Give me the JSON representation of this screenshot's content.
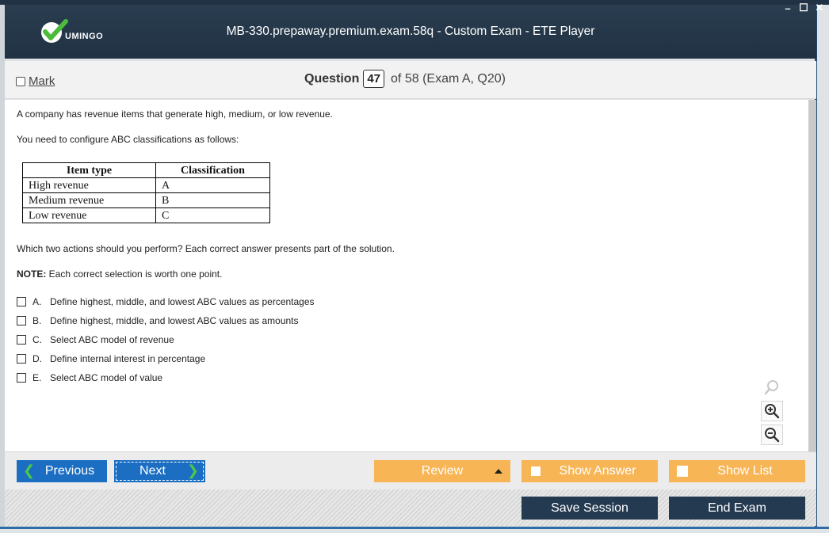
{
  "window": {
    "title": "MB-330.prepaway.premium.exam.58q - Custom Exam - ETE Player",
    "logo_text": "UMINGO",
    "controls": {
      "minimize": "–",
      "maximize": "☐",
      "close": "✕"
    },
    "accent_color": "#1b6ec2",
    "header_color": "#203243"
  },
  "question_bar": {
    "mark_label": "Mark",
    "question_label": "Question",
    "question_number": "47",
    "of_text": "of 58 (Exam A, Q20)"
  },
  "question": {
    "intro": "A company has revenue items that generate high, medium, or low revenue.",
    "requirement": "You need to configure ABC classifications as follows:",
    "table": {
      "headers": [
        "Item type",
        "Classification"
      ],
      "rows": [
        [
          "High revenue",
          "A"
        ],
        [
          "Medium revenue",
          "B"
        ],
        [
          "Low revenue",
          "C"
        ]
      ]
    },
    "prompt": "Which two actions should you perform? Each correct answer presents part of the solution.",
    "note_label": "NOTE:",
    "note_text": " Each correct selection is worth one point.",
    "options": [
      {
        "letter": "A.",
        "text": "Define highest, middle, and lowest ABC values as percentages"
      },
      {
        "letter": "B.",
        "text": "Define highest, middle, and lowest ABC values as amounts"
      },
      {
        "letter": "C.",
        "text": "Select ABC model of revenue"
      },
      {
        "letter": "D.",
        "text": "Define internal interest in percentage"
      },
      {
        "letter": "E.",
        "text": "Select ABC model of value"
      }
    ]
  },
  "zoom": {
    "icons": [
      "search-icon",
      "zoom-in-icon",
      "zoom-out-icon"
    ]
  },
  "nav": {
    "previous": "Previous",
    "next": "Next",
    "review": "Review",
    "show_answer": "Show Answer",
    "show_list": "Show List"
  },
  "actions": {
    "save_session": "Save Session",
    "end_exam": "End Exam"
  }
}
